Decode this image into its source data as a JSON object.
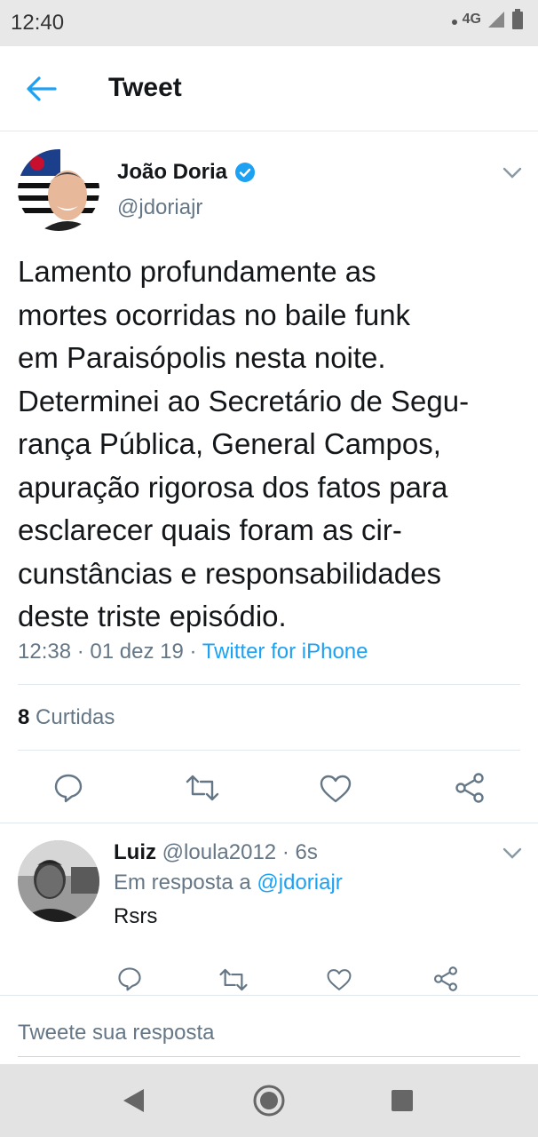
{
  "status_bar": {
    "time": "12:40",
    "network": "4G"
  },
  "app_bar": {
    "title": "Tweet",
    "back_icon": "back-arrow-icon"
  },
  "tweet": {
    "author_name": "João Doria",
    "author_handle": "@jdoriajr",
    "text_lines": [
      "Lamento profundamente as",
      "mortes ocorridas no baile funk",
      "em Paraisópolis nesta noite.",
      "Determinei ao Secretário de Segu-",
      "rança Pública, General Campos,",
      "apuração rigorosa dos fatos para",
      "esclarecer quais foram as cir-",
      "cunstâncias e responsabilidades",
      "deste triste episódio."
    ],
    "time": "12:38",
    "date": "01 dez 19",
    "source": "Twitter for iPhone",
    "likes_count": "8",
    "likes_label": "Curtidas"
  },
  "reply": {
    "name": "Luiz",
    "handle": "@loula2012",
    "age": "6s",
    "in_reply_prefix": "Em resposta a",
    "in_reply_handle": "@jdoriajr",
    "text": "Rsrs"
  },
  "compose": {
    "placeholder": "Tweete sua resposta"
  },
  "colors": {
    "accent": "#1da1f2",
    "secondary_text": "#657786",
    "divider": "#e1e8ed"
  }
}
